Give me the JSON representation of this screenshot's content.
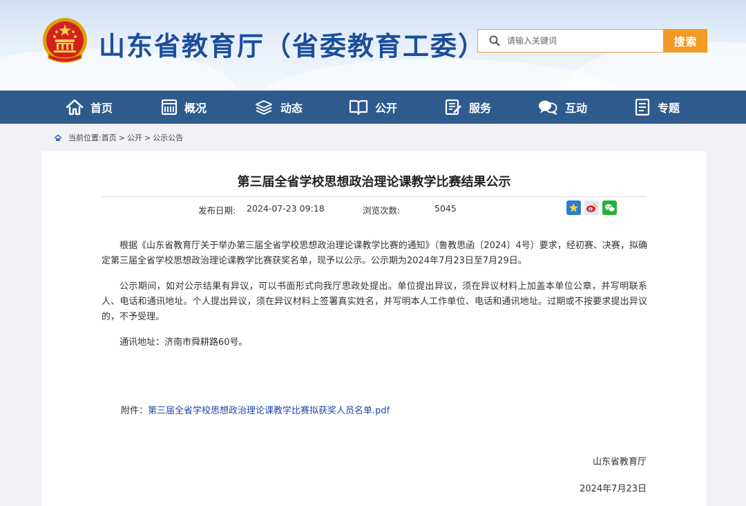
{
  "header": {
    "site_title": "山东省教育厅（省委教育工委）",
    "search_placeholder": "请输入关键词",
    "search_button": "搜索"
  },
  "nav": {
    "items": [
      {
        "label": "首页",
        "icon": "home-icon"
      },
      {
        "label": "概况",
        "icon": "overview-icon"
      },
      {
        "label": "动态",
        "icon": "news-icon"
      },
      {
        "label": "公开",
        "icon": "book-icon"
      },
      {
        "label": "服务",
        "icon": "service-icon"
      },
      {
        "label": "互动",
        "icon": "chat-icon"
      },
      {
        "label": "专题",
        "icon": "topic-icon"
      }
    ]
  },
  "breadcrumb": {
    "prefix": "当前位置:",
    "items": [
      "首页",
      "公开",
      "公示公告"
    ],
    "separator": ">"
  },
  "article": {
    "title": "第三届全省学校思想政治理论课教学比赛结果公示",
    "publish_label": "发布日期:",
    "publish_date": "2024-07-23 09:18",
    "views_label": "浏览次数:",
    "views": "5045",
    "share": [
      "qzone-icon",
      "weibo-icon",
      "wechat-icon"
    ],
    "paragraphs": [
      "根据《山东省教育厅关于举办第三届全省学校思想政治理论课教学比赛的通知》（鲁教思函〔2024〕4号）要求，经初赛、决赛，拟确定第三届全省学校思想政治理论课教学比赛获奖名单，现予以公示。公示期为2024年7月23日至7月29日。",
      "公示期间，如对公示结果有异议，可以书面形式向我厅思政处提出。单位提出异议，须在异议材料上加盖本单位公章，并写明联系人、电话和通讯地址。个人提出异议，须在异议材料上签署真实姓名，并写明本人工作单位、电话和通讯地址。过期或不按要求提出异议的，不予受理。",
      "通讯地址：济南市舜耕路60号。"
    ],
    "attachment_label": "附件：",
    "attachment_link": "第三届全省学校思想政治理论课教学比赛拟获奖人员名单.pdf",
    "sign_org": "山东省教育厅",
    "sign_date": "2024年7月23日"
  },
  "colors": {
    "title_blue": "#1d4e9c",
    "nav_bg": "#2f5a8e",
    "search_orange": "#f29a24",
    "link_blue": "#1f4aa8"
  }
}
